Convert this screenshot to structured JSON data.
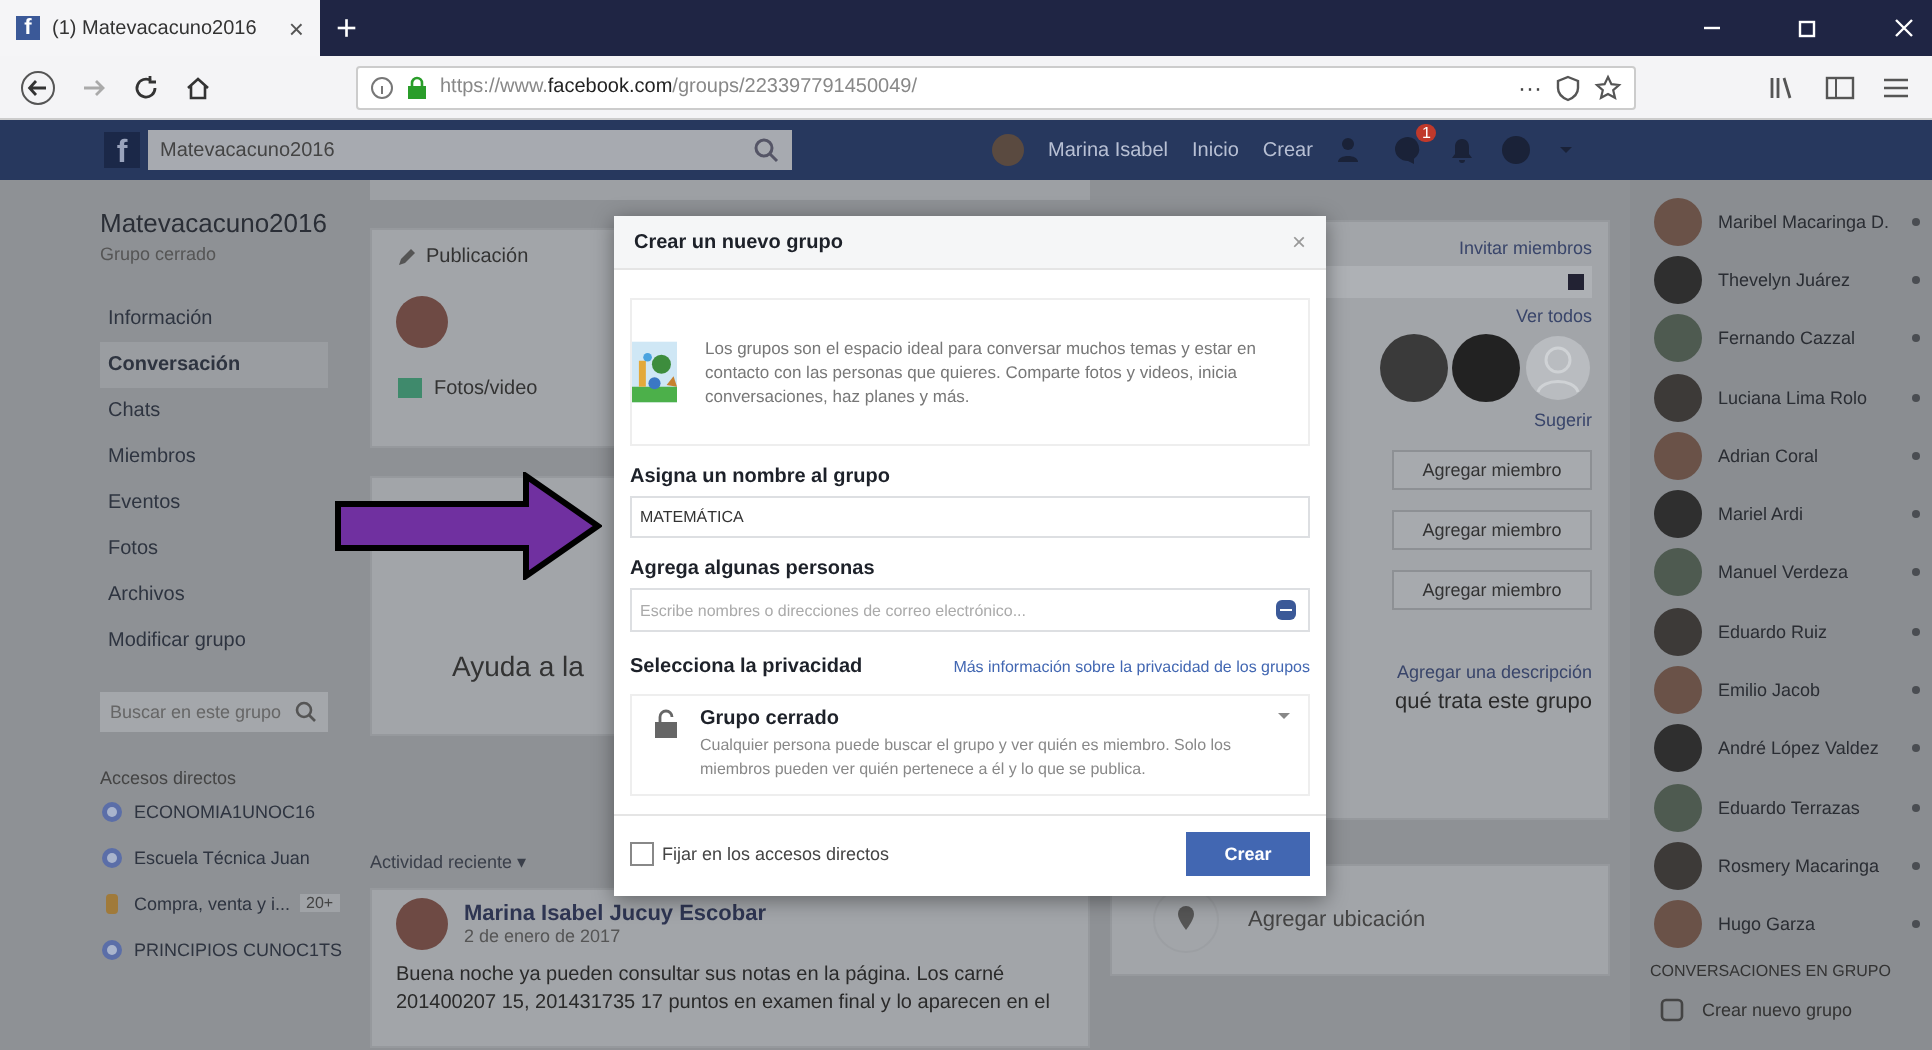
{
  "browser": {
    "favicon": "f",
    "tab_title": "(1) Matevacacuno2016",
    "close": "×",
    "new_tab": "+",
    "url_prefix": "https://www.",
    "url_domain": "facebook.com",
    "url_path": "/groups/223397791450049/",
    "page_actions": "···"
  },
  "facebook_bar": {
    "logo": "f",
    "search_value": "Matevacacuno2016",
    "user": "Marina Isabel",
    "nav": [
      "Inicio",
      "Crear"
    ],
    "notification_badge": "1"
  },
  "sidebar": {
    "group_name": "Matevacacuno2016",
    "group_type": "Grupo cerrado",
    "items": [
      {
        "label": "Información",
        "selected": false
      },
      {
        "label": "Conversación",
        "selected": true
      },
      {
        "label": "Chats",
        "selected": false
      },
      {
        "label": "Miembros",
        "selected": false
      },
      {
        "label": "Eventos",
        "selected": false
      },
      {
        "label": "Fotos",
        "selected": false
      },
      {
        "label": "Archivos",
        "selected": false
      },
      {
        "label": "Modificar grupo",
        "selected": false
      }
    ],
    "search_placeholder": "Buscar en este grupo",
    "shortcuts_title": "Accesos directos",
    "shortcuts": [
      {
        "label": "ECONOMIA1UNOC16",
        "kind": "group"
      },
      {
        "label": "Escuela Técnica Juan",
        "kind": "group"
      },
      {
        "label": "Compra, venta y i...",
        "kind": "page",
        "badge": "20+"
      },
      {
        "label": "PRINCIPIOS CUNOC1TS",
        "kind": "group"
      }
    ]
  },
  "composer": {
    "tabs": [
      "Publicación"
    ],
    "chip": "Fotos/video"
  },
  "help_card": {
    "title": "Ayuda a la"
  },
  "activity_label": "Actividad reciente ▾",
  "post": {
    "author": "Marina Isabel Jucuy Escobar",
    "date": "2 de enero de 2017",
    "text": "Buena noche ya pueden consultar sus notas en la página. Los carné 201400207 15, 201431735 17 puntos en examen final y lo aparecen en el"
  },
  "right_column": {
    "invite": "Invitar miembros",
    "see_all": "Ver todos",
    "suggest": "Sugerir",
    "add_buttons": [
      "Agregar miembro",
      "Agregar miembro",
      "Agregar miembro"
    ],
    "description_link": "Agregar una descripción",
    "description_text": "qué trata este grupo",
    "location": "Agregar ubicación"
  },
  "chat": {
    "contacts": [
      "Maribel Macaringa D.",
      "Thevelyn Juárez",
      "Fernando Cazzal",
      "Luciana Lima Rolo",
      "Adrian Coral",
      "Mariel Ardi",
      "Manuel Verdeza",
      "Eduardo Ruiz",
      "Emilio Jacob",
      "André López Valdez",
      "Eduardo Terrazas",
      "Rosmery Macaringa",
      "Hugo Garza"
    ],
    "group_title": "CONVERSACIONES EN GRUPO",
    "new_group": "Crear nuevo grupo"
  },
  "dialog": {
    "title": "Crear un nuevo grupo",
    "close": "×",
    "intro": "Los grupos son el espacio ideal para conversar muchos temas y estar en contacto con las personas que quieres. Comparte fotos y videos, inicia conversaciones, haz planes y más.",
    "name_label": "Asigna un nombre al grupo",
    "name_value": "MATEMÁTICA",
    "people_label": "Agrega algunas personas",
    "people_placeholder": "Escribe nombres o direcciones de correo electrónico...",
    "privacy_label": "Selecciona la privacidad",
    "privacy_link": "Más información sobre la privacidad de los grupos",
    "privacy_option": "Grupo cerrado",
    "privacy_description": "Cualquier persona puede buscar el grupo y ver quién es miembro. Solo los miembros pueden ver quién pertenece a él y lo que se publica.",
    "pin_label": "Fijar en los accesos directos",
    "pin_checked": false,
    "create_button": "Crear"
  }
}
